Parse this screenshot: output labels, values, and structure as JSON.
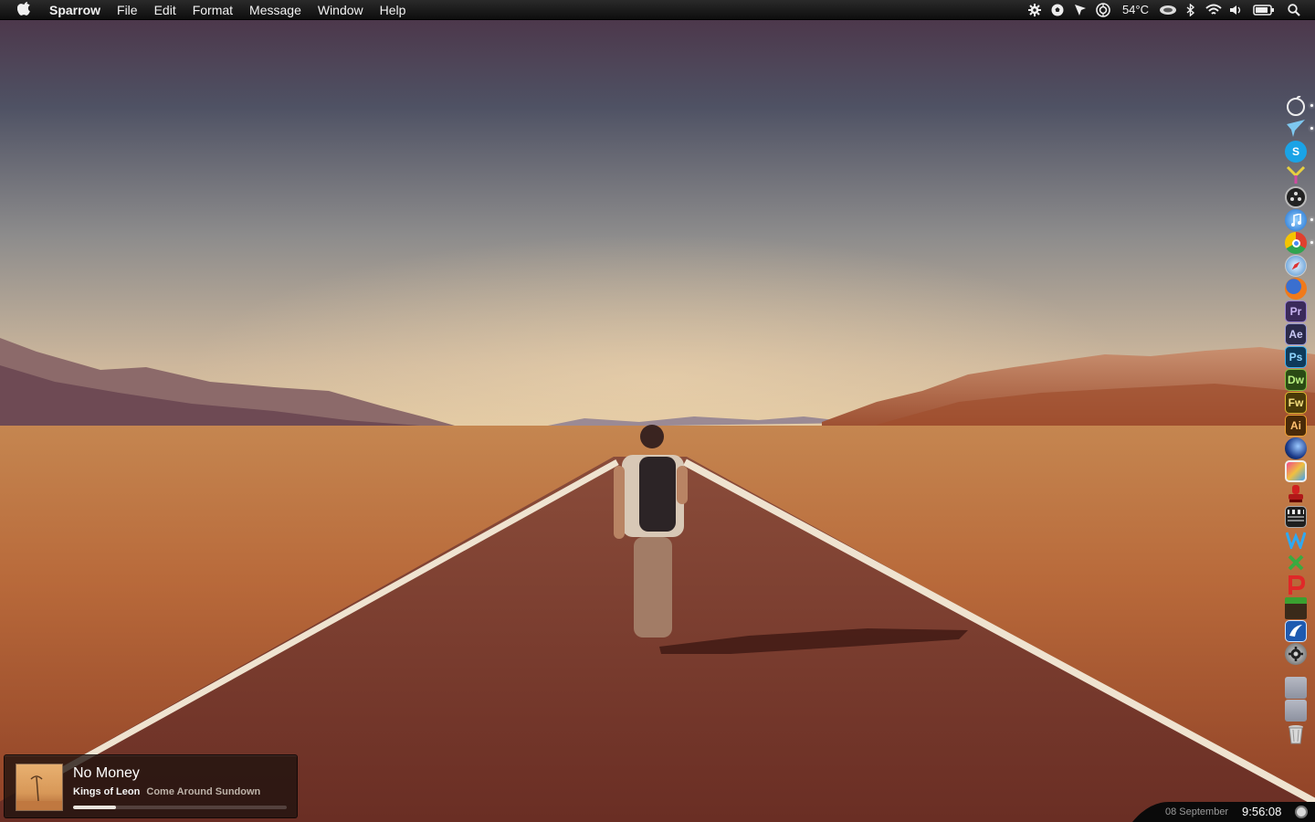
{
  "menubar": {
    "app_name": "Sparrow",
    "menus": [
      "File",
      "Edit",
      "Format",
      "Message",
      "Window",
      "Help"
    ],
    "status_icons": [
      "gear-icon",
      "soccer-ball-icon",
      "cursor-icon",
      "aperture-icon"
    ],
    "temperature": "54°C",
    "tray_icons": [
      "cloud-icon",
      "bluetooth-icon",
      "wifi-icon",
      "volume-icon",
      "battery-icon",
      "spotlight-search-icon"
    ]
  },
  "dock": {
    "items": [
      {
        "name": "finder-apple-icon",
        "running": true
      },
      {
        "name": "sparrow-icon",
        "running": true
      },
      {
        "name": "skype-icon",
        "running": false,
        "label": "S"
      },
      {
        "name": "adium-icon",
        "running": false
      },
      {
        "name": "reel-icon",
        "running": false
      },
      {
        "name": "itunes-icon",
        "running": true
      },
      {
        "name": "chrome-icon",
        "running": true
      },
      {
        "name": "safari-icon",
        "running": false
      },
      {
        "name": "firefox-icon",
        "running": false
      },
      {
        "name": "premiere-icon",
        "running": false,
        "label": "Pr"
      },
      {
        "name": "after-effects-icon",
        "running": false,
        "label": "Ae"
      },
      {
        "name": "photoshop-icon",
        "running": false,
        "label": "Ps"
      },
      {
        "name": "dreamweaver-icon",
        "running": false,
        "label": "Dw"
      },
      {
        "name": "fireworks-icon",
        "running": false,
        "label": "Fw"
      },
      {
        "name": "illustrator-icon",
        "running": false,
        "label": "Ai"
      },
      {
        "name": "cinema4d-icon",
        "running": false
      },
      {
        "name": "imovie-icon",
        "running": false
      },
      {
        "name": "stamp-icon",
        "running": false
      },
      {
        "name": "clapperboard-icon",
        "running": false
      },
      {
        "name": "wordpress-icon",
        "running": false
      },
      {
        "name": "x-app-icon",
        "running": false
      },
      {
        "name": "p-app-icon",
        "running": false
      },
      {
        "name": "minecraft-icon",
        "running": false
      },
      {
        "name": "ftp-app-icon",
        "running": false
      },
      {
        "name": "system-preferences-icon",
        "running": false
      },
      {
        "name": "documents-folder-icon",
        "running": false
      },
      {
        "name": "downloads-folder-icon",
        "running": false
      },
      {
        "name": "trash-icon",
        "running": false
      }
    ]
  },
  "nowplaying": {
    "title": "No Money",
    "artist": "Kings of Leon",
    "album": "Come Around Sundown",
    "progress": 0.2
  },
  "clock": {
    "date": "08 September",
    "time": "9:56:08"
  },
  "colors": {
    "sky_top": "#50394a",
    "sky_mid": "#5a6676",
    "horizon": "#d8c4a0",
    "desert": "#c47a3c",
    "road": "#7a3a2c"
  }
}
